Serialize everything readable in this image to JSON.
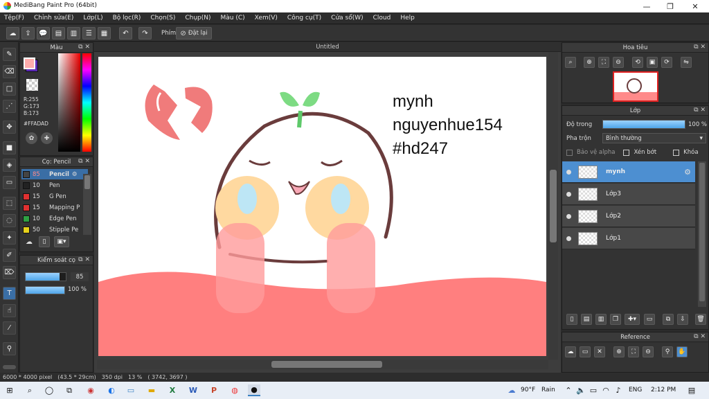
{
  "window": {
    "title": "MediBang Paint Pro (64bit)",
    "min": "—",
    "max": "❐",
    "close": "✕"
  },
  "menu": [
    "Tệp(F)",
    "Chỉnh sửa(E)",
    "Lớp(L)",
    "Bộ lọc(R)",
    "Chọn(S)",
    "Chụp(N)",
    "Màu (C)",
    "Xem(V)",
    "Công cụ(T)",
    "Cửa sổ(W)",
    "Cloud",
    "Help"
  ],
  "toolbar": {
    "shortcut_label": "Phím",
    "reset_label": "Đặt lại"
  },
  "canvas_tab": "Untitled",
  "canvas_text": {
    "line1": "mynh",
    "line2": "nguyenhue154",
    "line3": "#hd247"
  },
  "color_panel": {
    "title": "Màu",
    "r": "R:255",
    "g": "G:173",
    "b": "B:173",
    "hex": "#FFADAD",
    "primary": "#ffadad",
    "secondary": "#5b2bb5"
  },
  "brush_panel": {
    "title": "Cọ: Pencil",
    "items": [
      {
        "size": "85",
        "name": "Pencil",
        "color": "#444444"
      },
      {
        "size": "10",
        "name": "Pen",
        "color": "#222222"
      },
      {
        "size": "15",
        "name": "G Pen",
        "color": "#e03131"
      },
      {
        "size": "15",
        "name": "Mapping P",
        "color": "#e03131"
      },
      {
        "size": "10",
        "name": "Edge Pen",
        "color": "#2ea043"
      },
      {
        "size": "50",
        "name": "Stipple Pe",
        "color": "#e6d11b"
      }
    ]
  },
  "brush_control": {
    "title": "Kiểm soát cọ",
    "size": "85",
    "opacity": "100 %",
    "size_fraction": 0.85,
    "opacity_fraction": 1.0
  },
  "navigator": {
    "title": "Hoa tiêu"
  },
  "layers_panel": {
    "title": "Lớp",
    "opacity_label": "Độ trong",
    "opacity_value": "100 %",
    "opacity_fraction": 1.0,
    "blend_label": "Pha trộn",
    "blend_value": "Bình thường",
    "protect_alpha": "Bảo vệ alpha",
    "clipping": "Xén bớt",
    "lock": "Khóa",
    "layers": [
      {
        "name": "mynh",
        "selected": true
      },
      {
        "name": "Lớp3",
        "selected": false
      },
      {
        "name": "Lớp2",
        "selected": false
      },
      {
        "name": "Lớp1",
        "selected": false
      }
    ]
  },
  "reference_panel": {
    "title": "Reference"
  },
  "status": {
    "size": "6000 * 4000 pixel",
    "dims": "(43.5 * 29cm)",
    "dpi": "350 dpi",
    "zoom": "13 %",
    "coords": "( 3742, 3697 )"
  },
  "taskbar": {
    "weather_temp": "90°F",
    "weather_desc": "Rain",
    "lang": "ENG",
    "time": "2:12 PM"
  }
}
